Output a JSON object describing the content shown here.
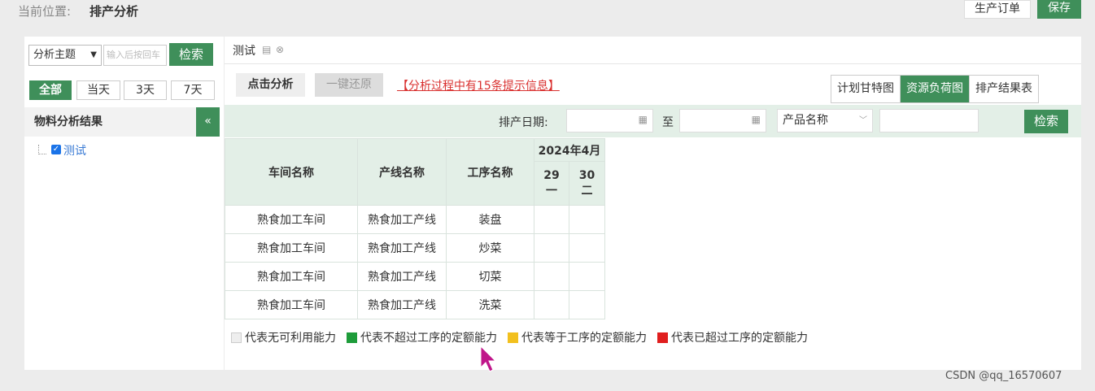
{
  "location": {
    "label": "当前位置:",
    "value": "排产分析"
  },
  "top_buttons": {
    "production_order": "生产订单",
    "save": "保存"
  },
  "left_panel": {
    "theme_select": "分析主题",
    "search_placeholder": "输入后按回车",
    "search_button": "检索",
    "ranges": [
      "全部",
      "当天",
      "3天",
      "7天"
    ],
    "active_range": "全部",
    "result_header": "物料分析结果",
    "collapse_icon": "«",
    "tree_item": "测试"
  },
  "main": {
    "tab_label": "测试",
    "analyze_button": "点击分析",
    "restore_button": "一键还原",
    "hint": "【分析过程中有15条提示信息】",
    "view_tabs": [
      "计划甘特图",
      "资源负荷图",
      "排产结果表"
    ],
    "active_view": "资源负荷图",
    "filter": {
      "date_label": "排产日期:",
      "to_label": "至",
      "product_select": "产品名称",
      "search_button": "检索"
    },
    "table": {
      "headers": [
        "车间名称",
        "产线名称",
        "工序名称"
      ],
      "month": "2024年4月",
      "days": [
        {
          "day": "29",
          "weekday": "一"
        },
        {
          "day": "30",
          "weekday": "二"
        }
      ],
      "rows": [
        [
          "熟食加工车间",
          "熟食加工产线",
          "装盘"
        ],
        [
          "熟食加工车间",
          "熟食加工产线",
          "炒菜"
        ],
        [
          "熟食加工车间",
          "熟食加工产线",
          "切菜"
        ],
        [
          "熟食加工车间",
          "熟食加工产线",
          "洗菜"
        ]
      ]
    },
    "legend": [
      {
        "label": "代表无可利用能力",
        "color": "#eeeeee"
      },
      {
        "label": "代表不超过工序的定额能力",
        "color": "#1e9c3a"
      },
      {
        "label": "代表等于工序的定额能力",
        "color": "#f2c01e"
      },
      {
        "label": "代表已超过工序的定额能力",
        "color": "#e01e1e"
      }
    ]
  },
  "watermark": "CSDN @qq_16570607"
}
